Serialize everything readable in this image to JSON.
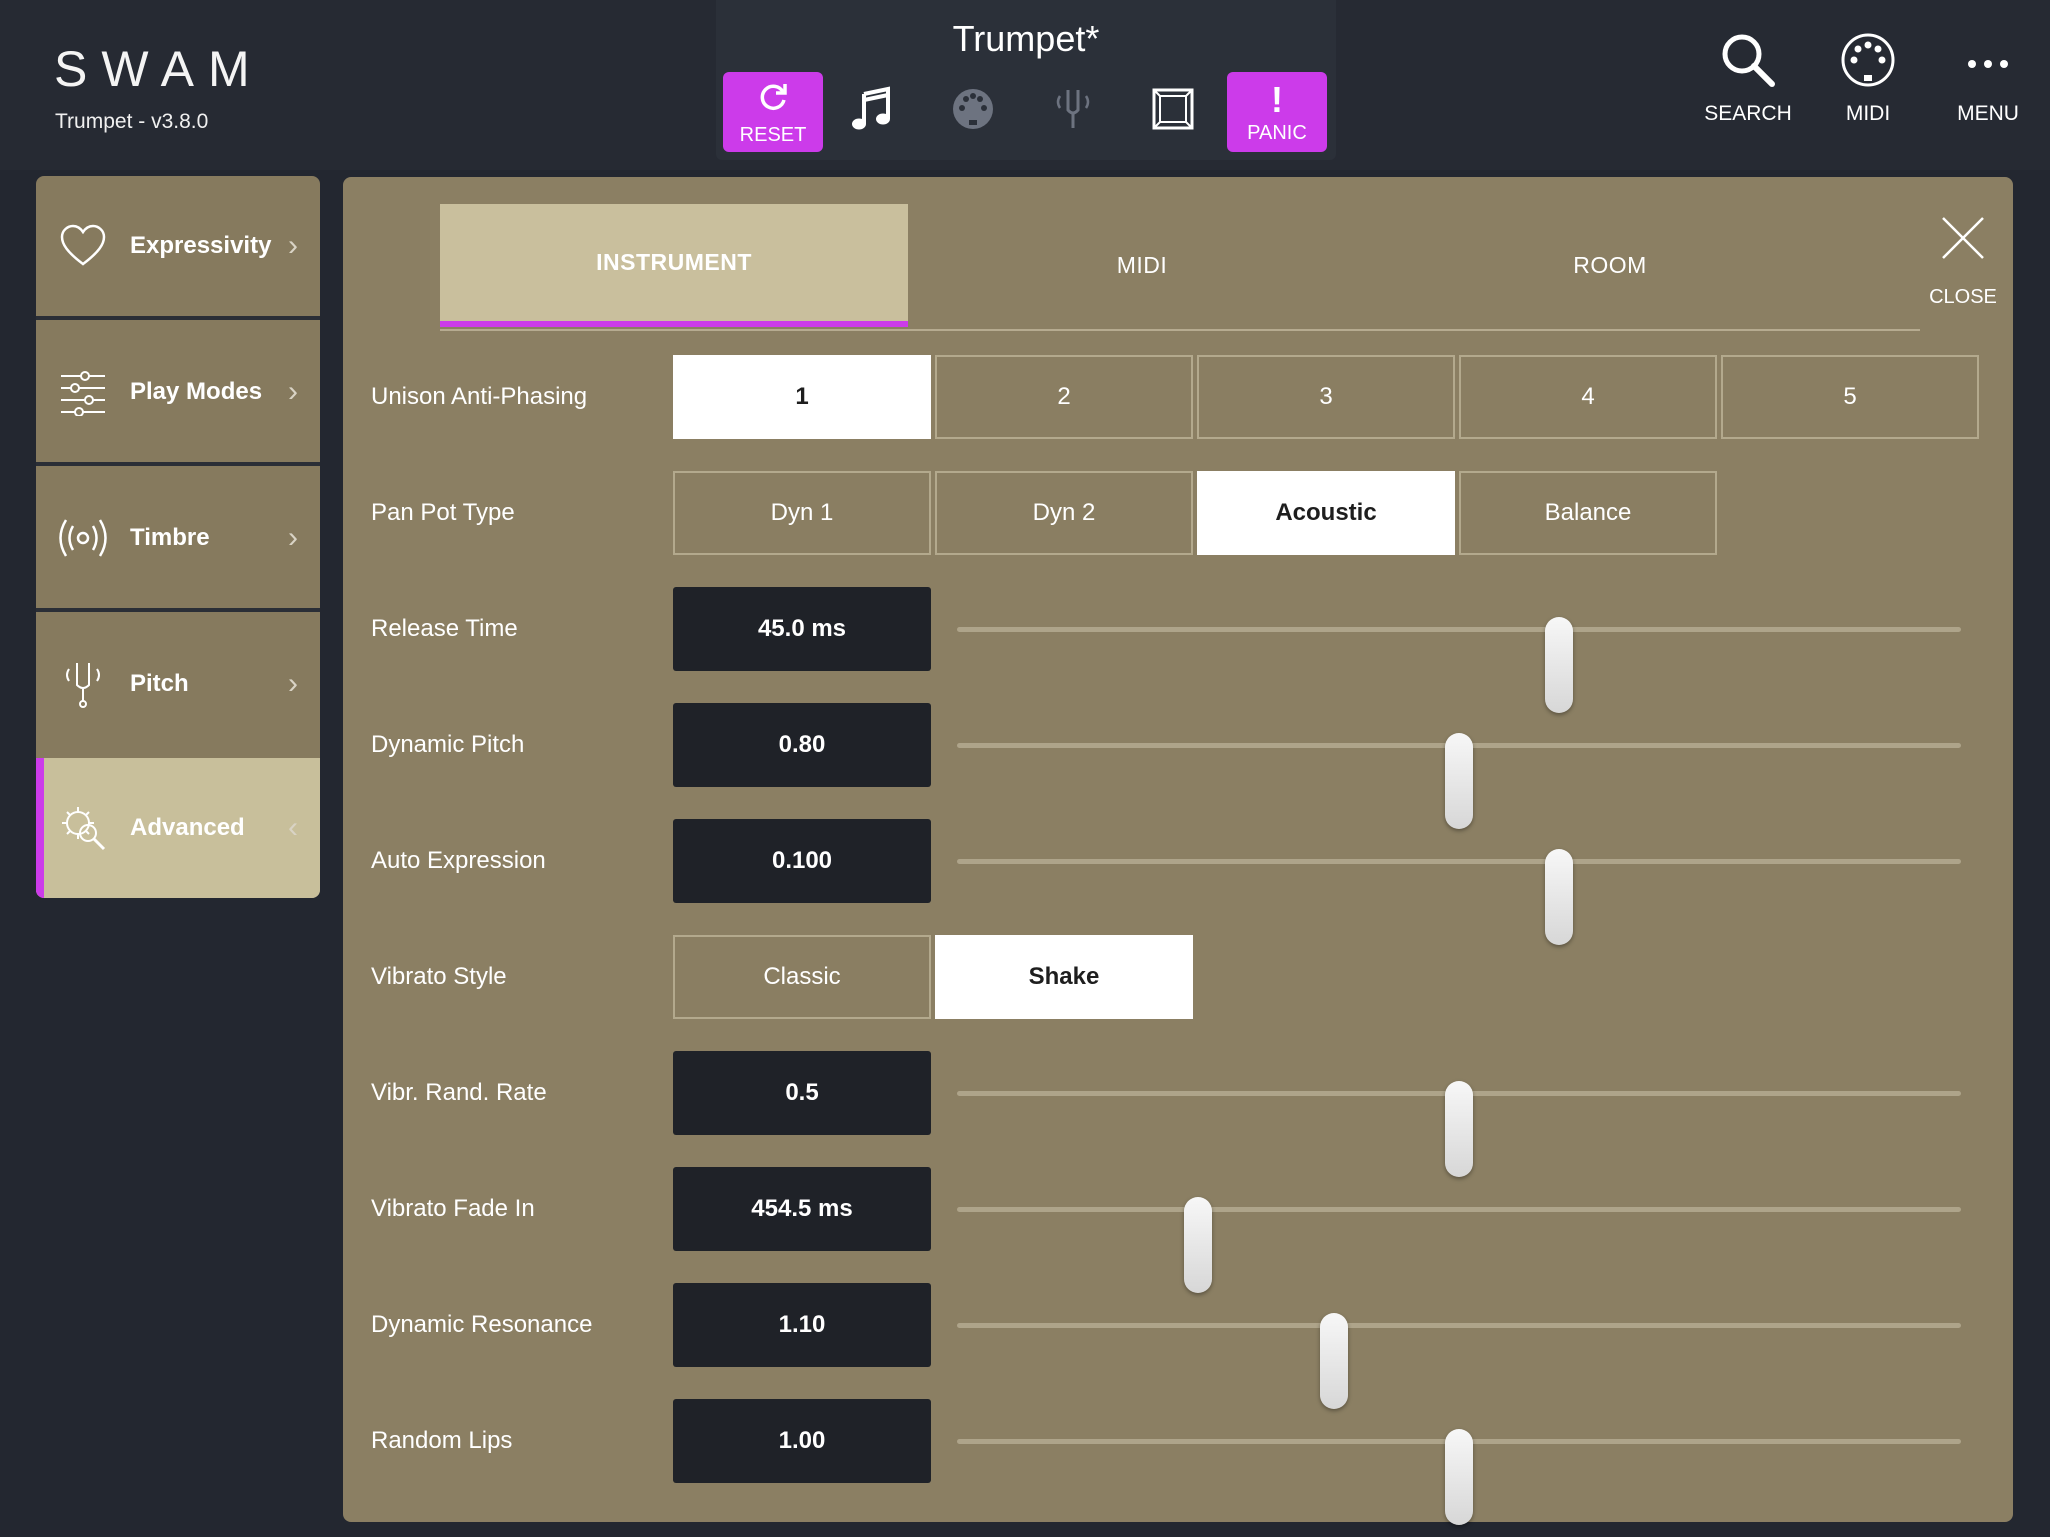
{
  "app": {
    "logo": "SWAM",
    "version": "Trumpet - v3.8.0",
    "preset_name": "Trumpet*"
  },
  "toolbar": {
    "reset_label": "RESET",
    "panic_label": "PANIC",
    "search_label": "SEARCH",
    "midi_label": "MIDI",
    "menu_label": "MENU"
  },
  "sidebar": {
    "items": [
      {
        "label": "Expressivity",
        "icon": "heart-icon"
      },
      {
        "label": "Play Modes",
        "icon": "sliders-icon"
      },
      {
        "label": "Timbre",
        "icon": "broadcast-icon"
      },
      {
        "label": "Pitch",
        "icon": "tuning-fork-icon"
      },
      {
        "label": "Advanced",
        "icon": "gear-search-icon",
        "active": true
      }
    ]
  },
  "tabs": {
    "instrument": "INSTRUMENT",
    "midi": "MIDI",
    "room": "ROOM",
    "close": "CLOSE"
  },
  "params": {
    "unison": {
      "label": "Unison Anti-Phasing",
      "options": [
        "1",
        "2",
        "3",
        "4",
        "5"
      ],
      "selected": 0
    },
    "panpot": {
      "label": "Pan Pot Type",
      "options": [
        "Dyn 1",
        "Dyn 2",
        "Acoustic",
        "Balance"
      ],
      "selected": 2
    },
    "release": {
      "label": "Release Time",
      "value": "45.0 ms",
      "level": 0.6
    },
    "dynpitch": {
      "label": "Dynamic Pitch",
      "value": "0.80",
      "level": 0.5
    },
    "autoexpr": {
      "label": "Auto Expression",
      "value": "0.100",
      "level": 0.6
    },
    "vibstyle": {
      "label": "Vibrato Style",
      "options": [
        "Classic",
        "Shake"
      ],
      "selected": 1
    },
    "vibrate": {
      "label": "Vibr. Rand. Rate",
      "value": "0.5",
      "level": 0.5
    },
    "vibfade": {
      "label": "Vibrato Fade In",
      "value": "454.5 ms",
      "level": 0.24
    },
    "dynres": {
      "label": "Dynamic Resonance",
      "value": "1.10",
      "level": 0.375
    },
    "randlips": {
      "label": "Random Lips",
      "value": "1.00",
      "level": 0.5
    }
  },
  "colors": {
    "accent": "#cc3bea",
    "panel": "#8b7f63",
    "active_tab": "#c9bf9d",
    "background": "#232730"
  }
}
